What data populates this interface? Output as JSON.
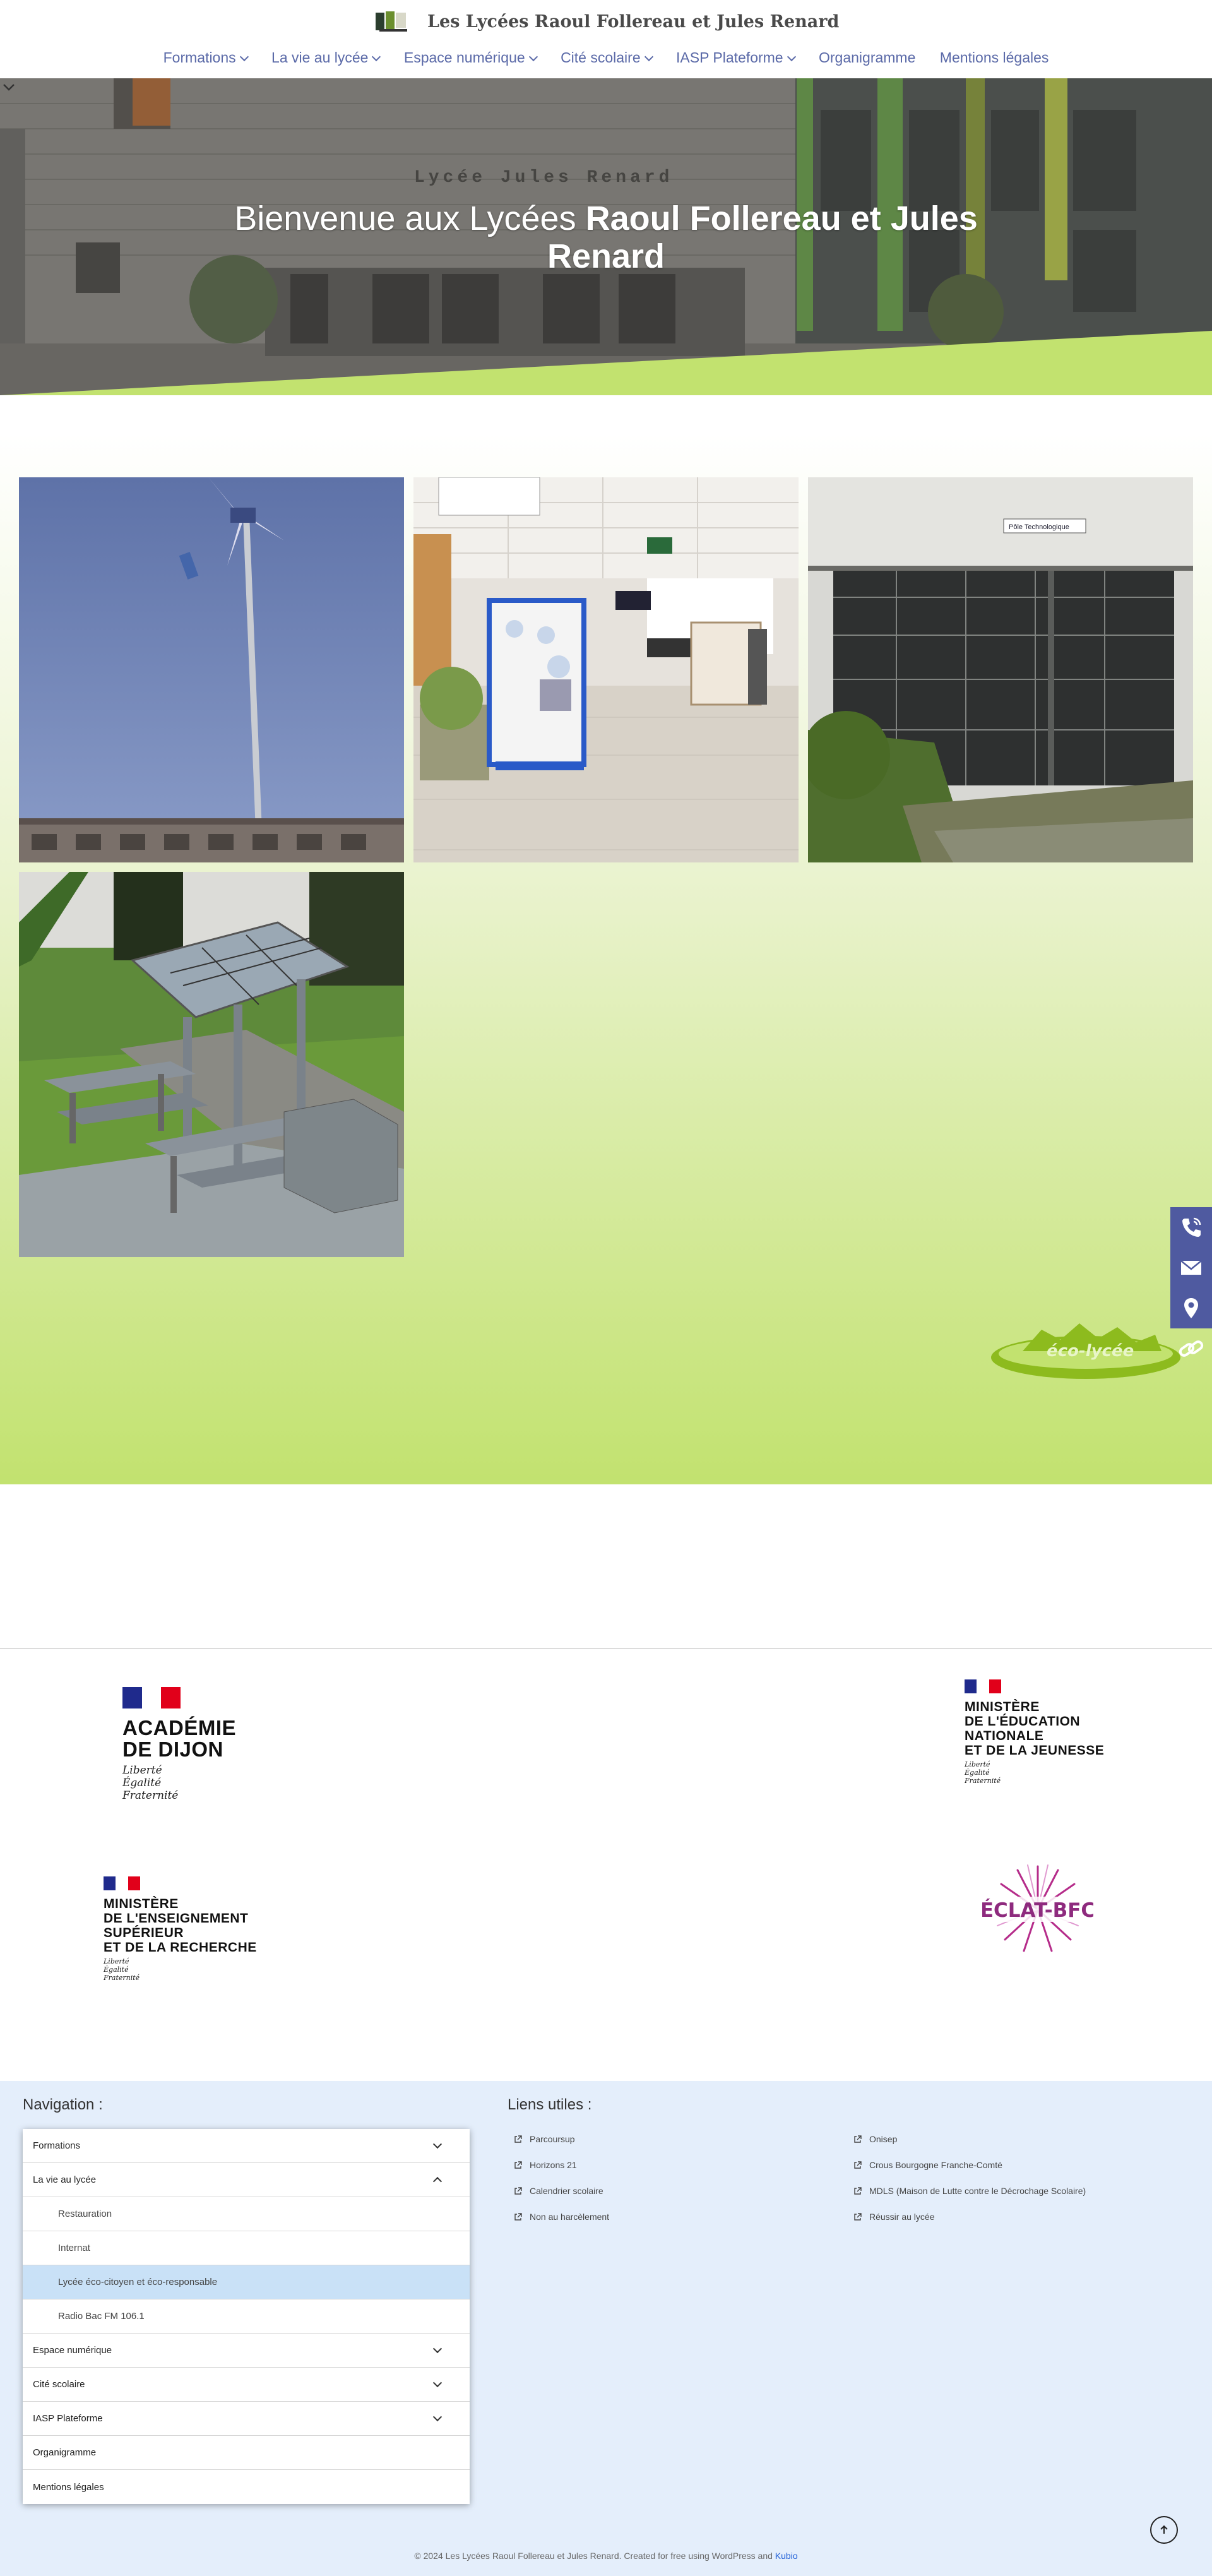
{
  "header": {
    "title": "Les Lycées Raoul Follereau et Jules Renard",
    "nav": [
      {
        "label": "Formations",
        "dropdown": true
      },
      {
        "label": "La vie au lycée",
        "dropdown": true
      },
      {
        "label": "Espace numérique",
        "dropdown": true
      },
      {
        "label": "Cité scolaire",
        "dropdown": true
      },
      {
        "label": "IASP Plateforme",
        "dropdown": true
      },
      {
        "label": "Organigramme",
        "dropdown": false
      },
      {
        "label": "Mentions légales",
        "dropdown": false
      }
    ]
  },
  "hero": {
    "title_prefix": "Bienvenue aux Lycées ",
    "title_bold": "Raoul Follereau et Jules Renard",
    "building_sign": "Lycée Jules Renard"
  },
  "gallery": {
    "hall_sign": "Pôle Technologique"
  },
  "side_icons": [
    "phone-icon",
    "mail-icon",
    "location-icon",
    "link-icon"
  ],
  "logos": {
    "academie": {
      "line1": "ACADÉMIE",
      "line2": "DE DIJON",
      "motto": [
        "Liberté",
        "Égalité",
        "Fraternité"
      ]
    },
    "education": {
      "lines": [
        "MINISTÈRE",
        "DE L'ÉDUCATION",
        "NATIONALE",
        "ET DE LA JEUNESSE"
      ],
      "motto": [
        "Liberté",
        "Égalité",
        "Fraternité"
      ]
    },
    "enseignement": {
      "lines": [
        "MINISTÈRE",
        "DE L'ENSEIGNEMENT",
        "SUPÉRIEUR",
        "ET DE LA RECHERCHE"
      ],
      "motto": [
        "Liberté",
        "Égalité",
        "Fraternité"
      ]
    },
    "eclat": "ÉCLAT-BFC",
    "ecolycee": "éco-lycée"
  },
  "footer": {
    "nav_heading": "Navigation :",
    "links_heading": "Liens utiles :",
    "menu": [
      {
        "label": "Formations",
        "sub": false,
        "chevron": "down",
        "active": false
      },
      {
        "label": "La vie au lycée",
        "sub": false,
        "chevron": "up",
        "active": false
      },
      {
        "label": "Restauration",
        "sub": true,
        "chevron": "",
        "active": false
      },
      {
        "label": "Internat",
        "sub": true,
        "chevron": "",
        "active": false
      },
      {
        "label": "Lycée éco-citoyen et éco-responsable",
        "sub": true,
        "chevron": "",
        "active": true
      },
      {
        "label": "Radio Bac FM 106.1",
        "sub": true,
        "chevron": "",
        "active": false
      },
      {
        "label": "Espace numérique",
        "sub": false,
        "chevron": "down",
        "active": false
      },
      {
        "label": "Cité scolaire",
        "sub": false,
        "chevron": "down",
        "active": false
      },
      {
        "label": "IASP Plateforme",
        "sub": false,
        "chevron": "down",
        "active": false
      },
      {
        "label": "Organigramme",
        "sub": false,
        "chevron": "",
        "active": false
      },
      {
        "label": "Mentions légales",
        "sub": false,
        "chevron": "",
        "active": false
      }
    ],
    "links_col1": [
      "Parcoursup",
      "Horizons 21",
      "Calendrier scolaire",
      "Non au harcèlement"
    ],
    "links_col2": [
      "Onisep",
      "Crous Bourgogne Franche-Comté",
      "MDLS (Maison de Lutte contre le Décrochage Scolaire)",
      "Réussir au lycée"
    ],
    "copyright": "© 2024 Les Lycées Raoul Follereau et Jules Renard. Created for free using WordPress and ",
    "copyright_link": "Kubio"
  },
  "colors": {
    "nav": "#5b6aa8",
    "lime": "#c2e26f",
    "side_bar": "#4f5aa0",
    "footer_bg": "#e4eefb",
    "menu_active": "#c9e1f7"
  }
}
